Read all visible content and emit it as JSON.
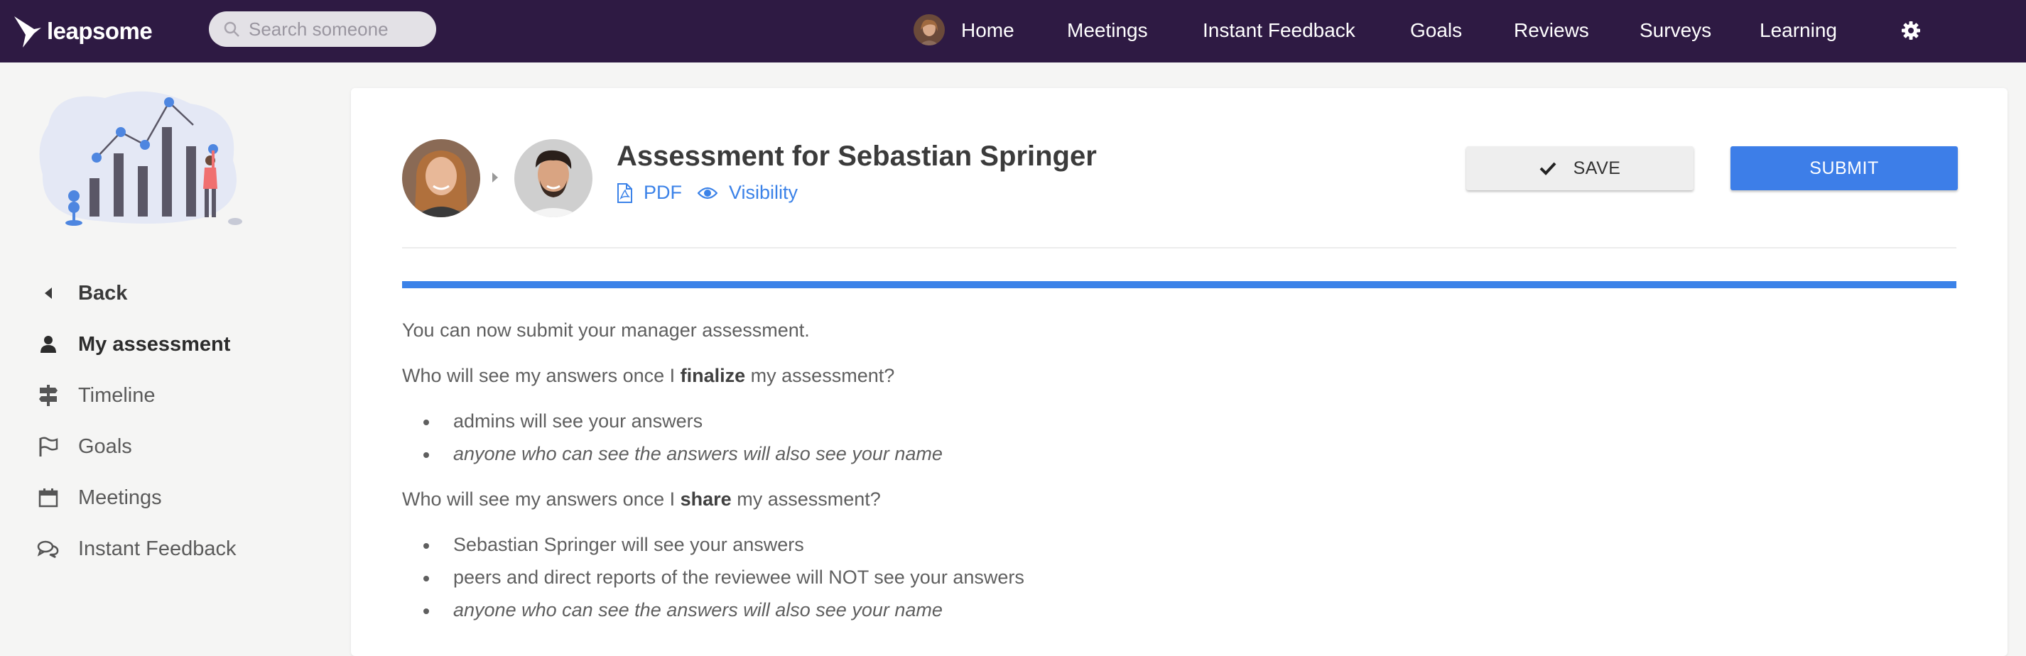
{
  "app": {
    "logo_text": "leapsome"
  },
  "search": {
    "placeholder": "Search someone"
  },
  "nav": {
    "items": [
      "Home",
      "Meetings",
      "Instant Feedback",
      "Goals",
      "Reviews",
      "Surveys",
      "Learning"
    ]
  },
  "sidebar": {
    "items": [
      {
        "label": "Back",
        "icon": "caret-left-icon"
      },
      {
        "label": "My assessment",
        "icon": "user-icon"
      },
      {
        "label": "Timeline",
        "icon": "signpost-icon"
      },
      {
        "label": "Goals",
        "icon": "flag-icon"
      },
      {
        "label": "Meetings",
        "icon": "calendar-icon"
      },
      {
        "label": "Instant Feedback",
        "icon": "chat-bubbles-icon"
      }
    ]
  },
  "assessment": {
    "title": "Assessment for Sebastian Springer",
    "pdf_label": "PDF",
    "visibility_label": "Visibility",
    "save_label": "SAVE",
    "submit_label": "SUBMIT",
    "progress": 1.0,
    "intro": "You can now submit your manager assessment.",
    "q1_before": "Who will see my answers once I ",
    "q1_bold": "finalize",
    "q1_after": " my assessment?",
    "q1_bullets": [
      "admins will see your answers",
      "anyone who can see the answers will also see your name"
    ],
    "q2_before": "Who will see my answers once I ",
    "q2_bold": "share",
    "q2_after": " my assessment?",
    "q2_bullets": [
      "Sebastian Springer will see your answers",
      "peers and direct reports of the reviewee will NOT see your answers",
      "anyone who can see the answers will also see your name"
    ]
  },
  "colors": {
    "nav_bg": "#2e1a43",
    "accent": "#3b82e8",
    "page_bg": "#f5f5f4"
  }
}
